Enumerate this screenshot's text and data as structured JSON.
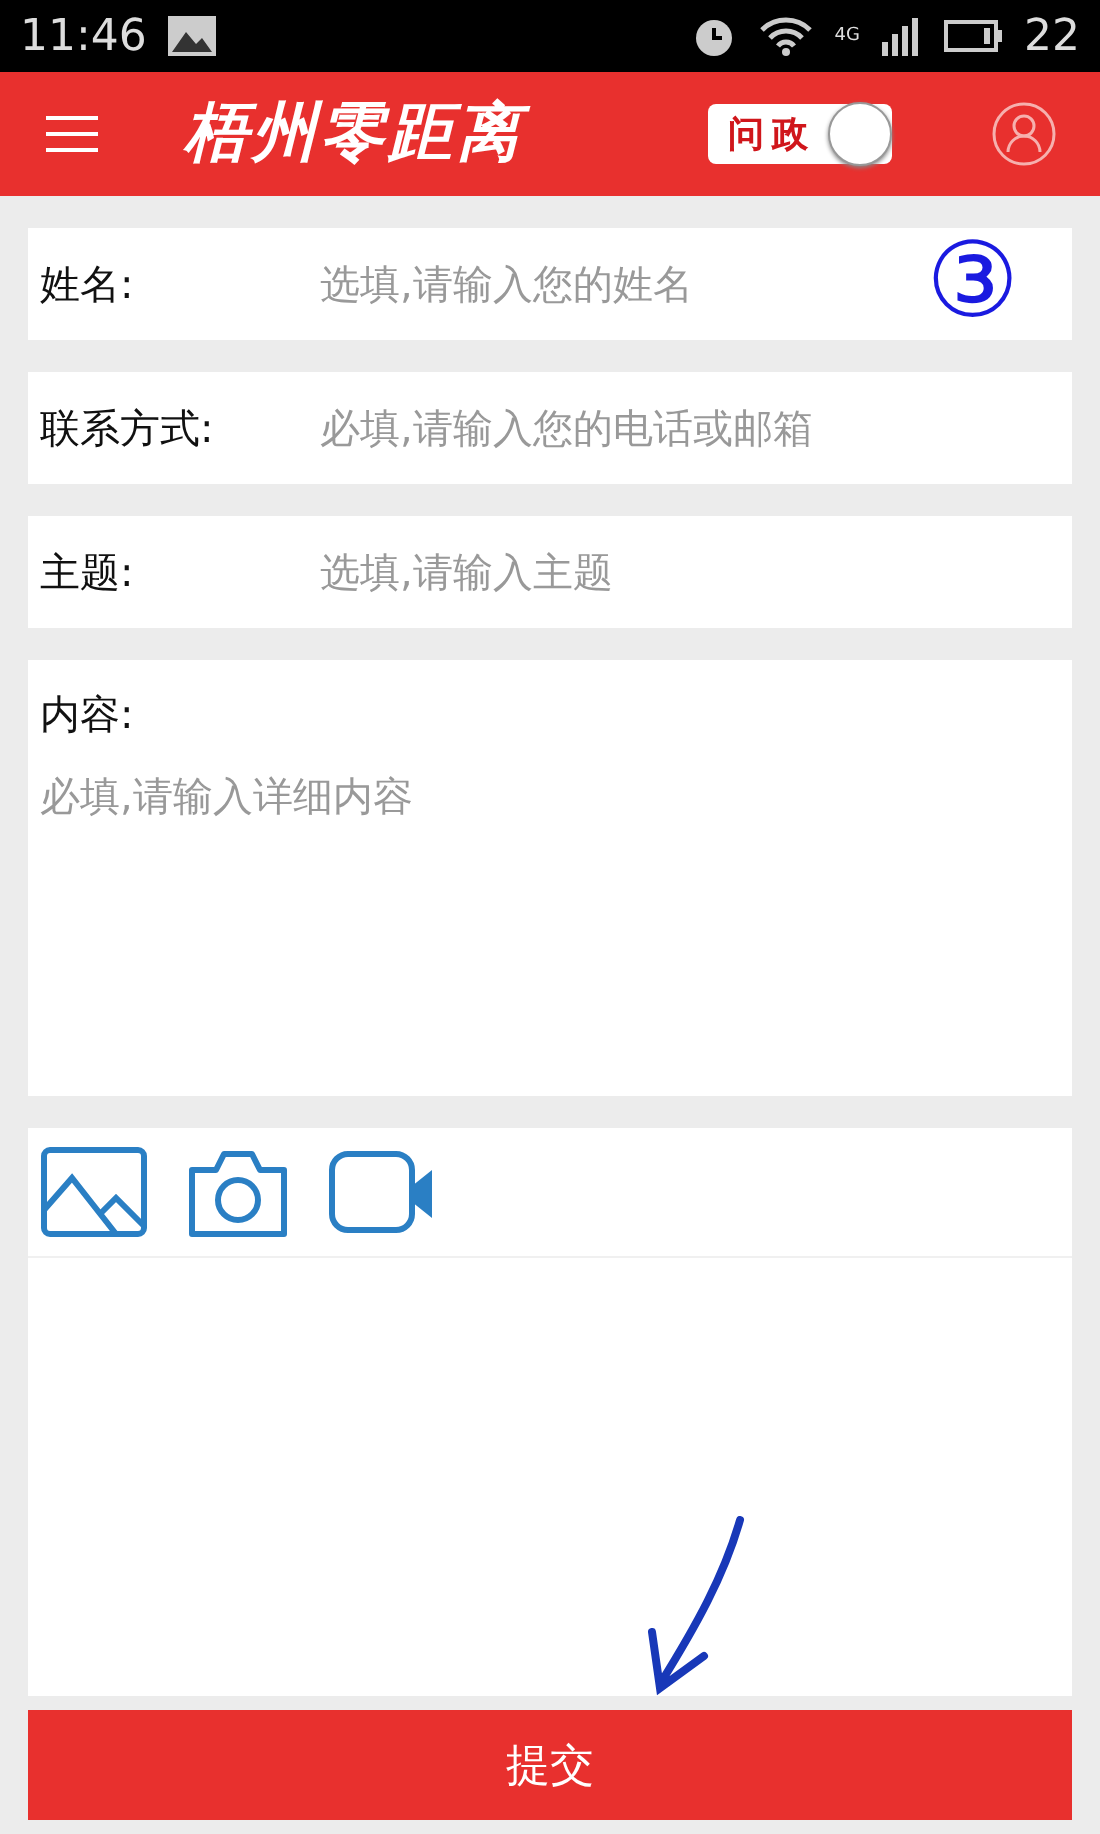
{
  "status_bar": {
    "time": "11:46",
    "network": "4G",
    "battery": "22"
  },
  "header": {
    "logo": "梧州零距离",
    "toggle": {
      "label": "问政",
      "on": true
    }
  },
  "fields": [
    {
      "label": "姓名:",
      "placeholder": "选填,请输入您的姓名"
    },
    {
      "label": "联系方式:",
      "placeholder": "必填,请输入您的电话或邮箱"
    },
    {
      "label": "主题:",
      "placeholder": "选填,请输入主题"
    }
  ],
  "content": {
    "label": "内容:",
    "placeholder": "必填,请输入详细内容"
  },
  "annotation": {
    "step": "③"
  },
  "submit": "提交"
}
